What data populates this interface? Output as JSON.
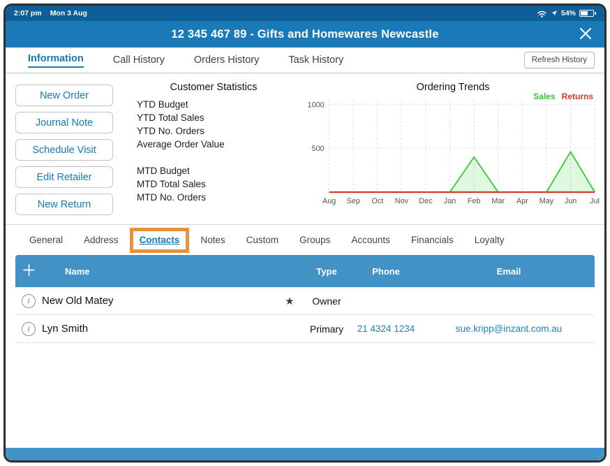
{
  "colors": {
    "status_bar": "#0f5e98",
    "title_bar": "#1b79b7",
    "table_header": "#4292c6",
    "accent_blue": "#1779b9",
    "link_blue": "#1e84c0",
    "highlight_orange": "#e8923b",
    "sales_green": "#35c935",
    "returns_red": "#d43a2a"
  },
  "status_bar": {
    "time": "2:07 pm",
    "date": "Mon 3 Aug",
    "battery": "54%"
  },
  "title_bar": {
    "title": "12 345 467 89 - Gifts and Homewares Newcastle"
  },
  "main_tabs": {
    "items": [
      {
        "label": "Information",
        "active": true
      },
      {
        "label": "Call History",
        "active": false
      },
      {
        "label": "Orders History",
        "active": false
      },
      {
        "label": "Task History",
        "active": false
      }
    ],
    "refresh_label": "Refresh History"
  },
  "actions": {
    "buttons": [
      {
        "label": "New Order"
      },
      {
        "label": "Journal Note"
      },
      {
        "label": "Schedule Visit"
      },
      {
        "label": "Edit Retailer"
      },
      {
        "label": "New Return"
      }
    ]
  },
  "customer_statistics": {
    "title": "Customer Statistics",
    "ytd_items": [
      "YTD Budget",
      "YTD Total Sales",
      "YTD No. Orders",
      "Average Order Value"
    ],
    "mtd_items": [
      "MTD Budget",
      "MTD Total Sales",
      "MTD No. Orders"
    ]
  },
  "chart_data": {
    "type": "area",
    "title": "Ordering Trends",
    "categories": [
      "Aug",
      "Sep",
      "Oct",
      "Nov",
      "Dec",
      "Jan",
      "Feb",
      "Mar",
      "Apr",
      "May",
      "Jun",
      "Jul"
    ],
    "series": [
      {
        "name": "Sales",
        "color": "#35c935",
        "values": [
          0,
          0,
          0,
          0,
          0,
          0,
          400,
          0,
          0,
          0,
          460,
          0
        ]
      },
      {
        "name": "Returns",
        "color": "#d43a2a",
        "values": [
          0,
          0,
          0,
          0,
          0,
          0,
          0,
          0,
          0,
          0,
          0,
          0
        ]
      }
    ],
    "ylim": [
      0,
      1050
    ],
    "yticks": [
      500,
      1000
    ],
    "grid": "dashed-vertical",
    "legend_position": "top-right"
  },
  "sub_tabs": {
    "items": [
      {
        "label": "General",
        "active": false
      },
      {
        "label": "Address",
        "active": false
      },
      {
        "label": "Contacts",
        "active": true,
        "highlighted": true
      },
      {
        "label": "Notes",
        "active": false
      },
      {
        "label": "Custom",
        "active": false
      },
      {
        "label": "Groups",
        "active": false
      },
      {
        "label": "Accounts",
        "active": false
      },
      {
        "label": "Financials",
        "active": false
      },
      {
        "label": "Loyalty",
        "active": false
      }
    ]
  },
  "contacts_table": {
    "columns": [
      "Name",
      "Type",
      "Phone",
      "Email"
    ],
    "rows": [
      {
        "name": "New Old Matey",
        "starred": true,
        "type": "Owner",
        "phone": "",
        "email": ""
      },
      {
        "name": "Lyn Smith",
        "starred": false,
        "type": "Primary",
        "phone": "21 4324 1234",
        "email": "sue.kripp@inzant.com.au"
      }
    ]
  }
}
